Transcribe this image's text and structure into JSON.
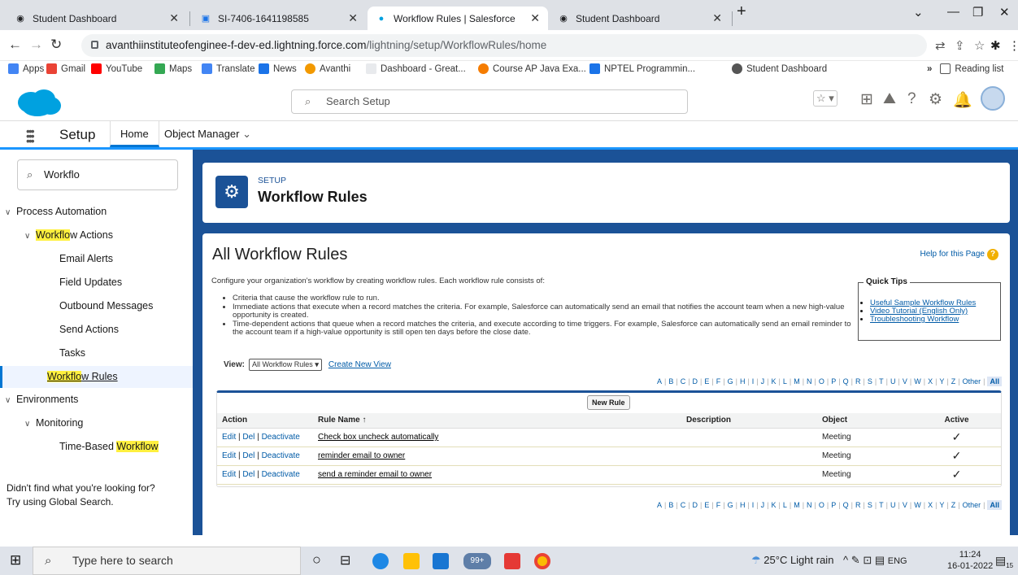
{
  "browser": {
    "tabs": [
      {
        "label": "Student Dashboard",
        "icon": "globe-icon"
      },
      {
        "label": "SI-7406-1641198585",
        "icon": "doc-icon"
      },
      {
        "label": "Workflow Rules | Salesforce",
        "icon": "salesforce-cloud-icon",
        "active": true
      },
      {
        "label": "Student Dashboard",
        "icon": "globe-icon"
      }
    ],
    "url_host": "avanthiinstituteofenginee-f-dev-ed.lightning.force.com",
    "url_path": "/lightning/setup/WorkflowRules/home",
    "bookmarks": [
      "Apps",
      "Gmail",
      "YouTube",
      "Maps",
      "Translate",
      "News",
      "Avanthi",
      "Dashboard - Great...",
      "Course AP Java Exa...",
      "NPTEL Programmin...",
      "Student Dashboard"
    ],
    "reading_list": "Reading list"
  },
  "header": {
    "search_placeholder": "Search Setup"
  },
  "appbar": {
    "app_name": "Setup",
    "tabs": [
      "Home",
      "Object Manager"
    ]
  },
  "sidebar": {
    "quick_find": "Workflo",
    "items": {
      "process_automation": "Process Automation",
      "workflow_actions_hl": "Workflo",
      "workflow_actions_rest": "w Actions",
      "email_alerts": "Email Alerts",
      "field_updates": "Field Updates",
      "outbound_messages": "Outbound Messages",
      "send_actions": "Send Actions",
      "tasks": "Tasks",
      "workflow_rules_hl": "Workflo",
      "workflow_rules_rest": "w Rules",
      "environments": "Environments",
      "monitoring": "Monitoring",
      "time_based_pre": "Time-Based ",
      "time_based_hl": "Workflow"
    },
    "not_found_line1": "Didn't find what you're looking for?",
    "not_found_line2": "Try using Global Search."
  },
  "title_card": {
    "eyebrow": "SETUP",
    "title": "Workflow Rules"
  },
  "main": {
    "heading": "All Workflow Rules",
    "help": "Help for this Page",
    "intro": "Configure your organization's workflow by creating workflow rules. Each workflow rule consists of:",
    "bullets": [
      "Criteria that cause the workflow rule to run.",
      "Immediate actions that execute when a record matches the criteria. For example, Salesforce can automatically send an email that notifies the account team when a new high-value opportunity is created.",
      "Time-dependent actions that queue when a record matches the criteria, and execute according to time triggers. For example, Salesforce can automatically send an email reminder to the account team if a high-value opportunity is still open ten days before the close date."
    ],
    "quick_tips_title": "Quick Tips",
    "quick_tips": [
      "Useful Sample Workflow Rules",
      "Video Tutorial (English Only)",
      "Troubleshooting Workflow"
    ],
    "view_label": "View:",
    "view_value": "All Workflow Rules",
    "create_view": "Create New View",
    "alphabet": [
      "A",
      "B",
      "C",
      "D",
      "E",
      "F",
      "G",
      "H",
      "I",
      "J",
      "K",
      "L",
      "M",
      "N",
      "O",
      "P",
      "Q",
      "R",
      "S",
      "T",
      "U",
      "V",
      "W",
      "X",
      "Y",
      "Z",
      "Other",
      "All"
    ],
    "new_rule": "New Rule",
    "columns": {
      "action": "Action",
      "rule_name": "Rule Name ↑",
      "description": "Description",
      "object": "Object",
      "active": "Active"
    },
    "action_links": {
      "edit": "Edit",
      "del": "Del",
      "deactivate": "Deactivate"
    },
    "rows": [
      {
        "rule_name": "Check box uncheck automatically",
        "description": "",
        "object": "Meeting",
        "active": "✓"
      },
      {
        "rule_name": "reminder email to owner",
        "description": "",
        "object": "Meeting",
        "active": "✓"
      },
      {
        "rule_name": "send a reminder email to owner",
        "description": "",
        "object": "Meeting",
        "active": "✓"
      }
    ]
  },
  "taskbar": {
    "search_placeholder": "Type here to search",
    "badge": "99+",
    "weather": "25°C  Light rain",
    "lang": "ENG",
    "time": "11:24",
    "date": "16-01-2022",
    "notif": "15"
  }
}
